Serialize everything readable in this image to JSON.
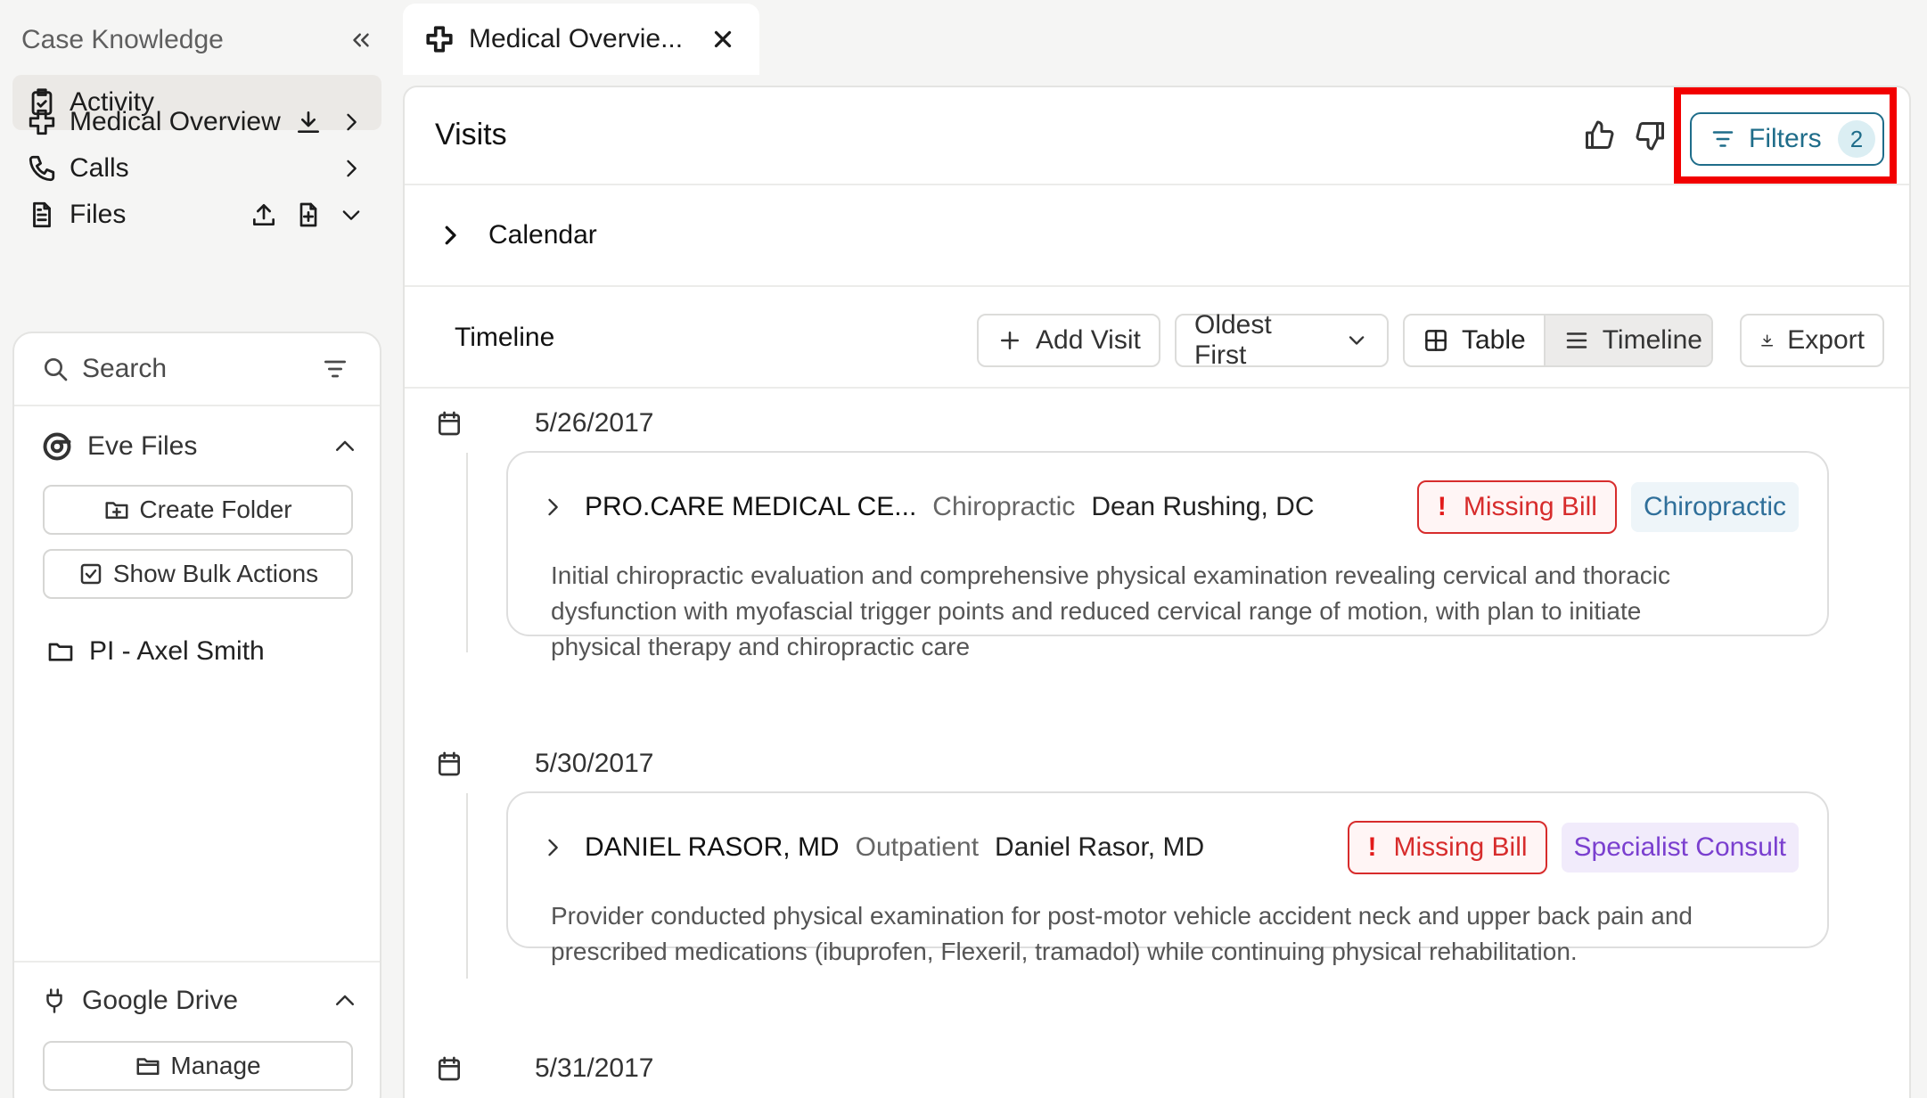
{
  "sidebar": {
    "title": "Case Knowledge",
    "items": [
      {
        "label": "Activity"
      },
      {
        "label": "Medical Overview"
      },
      {
        "label": "Calls"
      },
      {
        "label": "Files"
      }
    ],
    "files_panel": {
      "search_label": "Search",
      "eve_files_label": "Eve Files",
      "create_folder_label": "Create Folder",
      "bulk_actions_label": "Show Bulk Actions",
      "folder_label": "PI - Axel Smith",
      "google_drive_label": "Google Drive",
      "manage_label": "Manage"
    }
  },
  "tab": {
    "label": "Medical Overvie..."
  },
  "main": {
    "title": "Visits",
    "filters_label": "Filters",
    "filters_count": "2",
    "calendar_label": "Calendar",
    "timeline_label": "Timeline",
    "toolbar": {
      "add_visit_label": "Add Visit",
      "sort_label": "Oldest First",
      "table_label": "Table",
      "timeline_view_label": "Timeline",
      "export_label": "Export"
    }
  },
  "visits": [
    {
      "date": "5/26/2017",
      "provider": "PRO.CARE MEDICAL CE...",
      "type": "Chiropractic",
      "doctor": "Dean Rushing, DC",
      "status": "Missing Bill",
      "category": "Chiropractic",
      "category_text_color": "#2f6f9a",
      "category_bg_color": "#eef5f9",
      "description": "Initial chiropractic evaluation and comprehensive physical examination revealing cervical and thoracic dysfunction with myofascial trigger points and reduced cervical range of motion, with plan to initiate physical therapy and chiropractic care"
    },
    {
      "date": "5/30/2017",
      "provider": "DANIEL RASOR, MD",
      "type": "Outpatient",
      "doctor": "Daniel Rasor, MD",
      "status": "Missing Bill",
      "category": "Specialist Consult",
      "category_text_color": "#7a3fcf",
      "category_bg_color": "#f1ebfb",
      "description": "Provider conducted physical examination for post-motor vehicle accident neck and upper back pain and prescribed medications (ibuprofen, Flexeril, tramadol) while continuing physical rehabilitation."
    },
    {
      "date": "5/31/2017"
    }
  ],
  "colors": {
    "accent": "#1f6d8a",
    "missing_bill": "#d72c2c",
    "highlight": "#f20000"
  }
}
